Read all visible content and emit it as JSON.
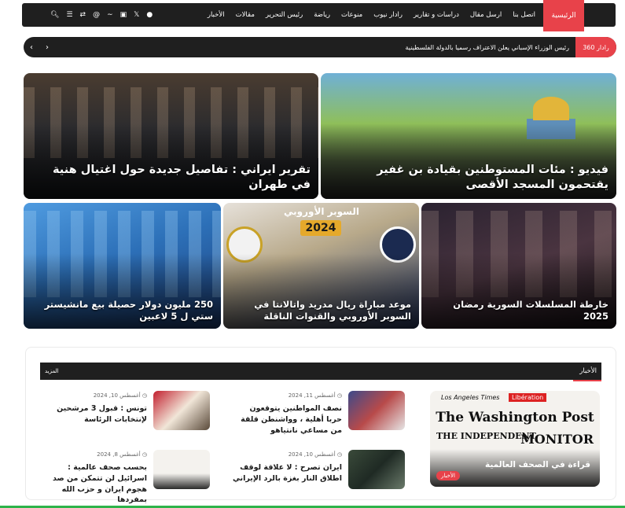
{
  "nav": {
    "home": "الرئيسية",
    "links": [
      "الأخبار",
      "مقالات",
      "رئيس التحرير",
      "رياضة",
      "منوعات",
      "رادار نيوب",
      "دراسات و تقارير",
      "ارسل مقال",
      "اتصل بنا"
    ],
    "icons": [
      "facebook-icon",
      "x-icon",
      "instagram-icon",
      "rss-icon",
      "threads-icon",
      "random-icon",
      "menu-icon",
      "search-icon"
    ]
  },
  "ticker": {
    "label": "رادار 360",
    "text": "رئيس الوزراء الإسباني يعلن الاعتراف رسميا بالدولة الفلسطينية"
  },
  "hero": [
    {
      "caption": "فيديو : مئات المستوطنين بقيادة بن غفير يقتحمون المسجد الأقصى"
    },
    {
      "caption": "تقرير ايراني : تفاصيل جديدة حول اغتيال هنية في طهران"
    }
  ],
  "small": [
    {
      "caption": "خارطة المسلسلات السورية رمضان 2025"
    },
    {
      "caption": "موعد مباراة ريال مدريد واتالانتا في السوبر الأوروبي والقنوات الناقلة",
      "overlay_title": "السوبر الأوروبي",
      "overlay_year": "2024"
    },
    {
      "caption": "250 مليون دولار حصيلة بيع مانشيستر ستي ل 5 لاعبين"
    }
  ],
  "news": {
    "title": "الأخبار",
    "more": "المزيد",
    "feature": {
      "caption": "قراءة في الصحف العالمية",
      "tag": "الأخبار",
      "papers": {
        "la": "Los Angeles Times",
        "lib": "Libération",
        "wp": "The Washington Post",
        "ind": "THE INDEPENDENT",
        "mon": "MONITOR"
      }
    },
    "items": [
      {
        "date": "أغسطس 11, 2024",
        "title": "نصف المواطنين يتوقعون حربا أهلية ، وواشنطن قلقة من مساعي نانتياهو"
      },
      {
        "date": "أغسطس 10, 2024",
        "title": "تونس : قبول 3 مرشحين لإنتخابات الرئاسة"
      },
      {
        "date": "أغسطس 10, 2024",
        "title": "ايران تصرح : لا علاقة لوقف اطلاق النار بغزة بالرد الإيراني"
      },
      {
        "date": "أغسطس 8, 2024",
        "title": "بحسب صحف عالمية : اسرائيل لن تتمكن من صد هجوم ايران و حزب الله بمفردها"
      }
    ]
  },
  "colors": {
    "accent": "#e8424a",
    "dark": "#1f1f1f",
    "green": "#2db34a"
  }
}
